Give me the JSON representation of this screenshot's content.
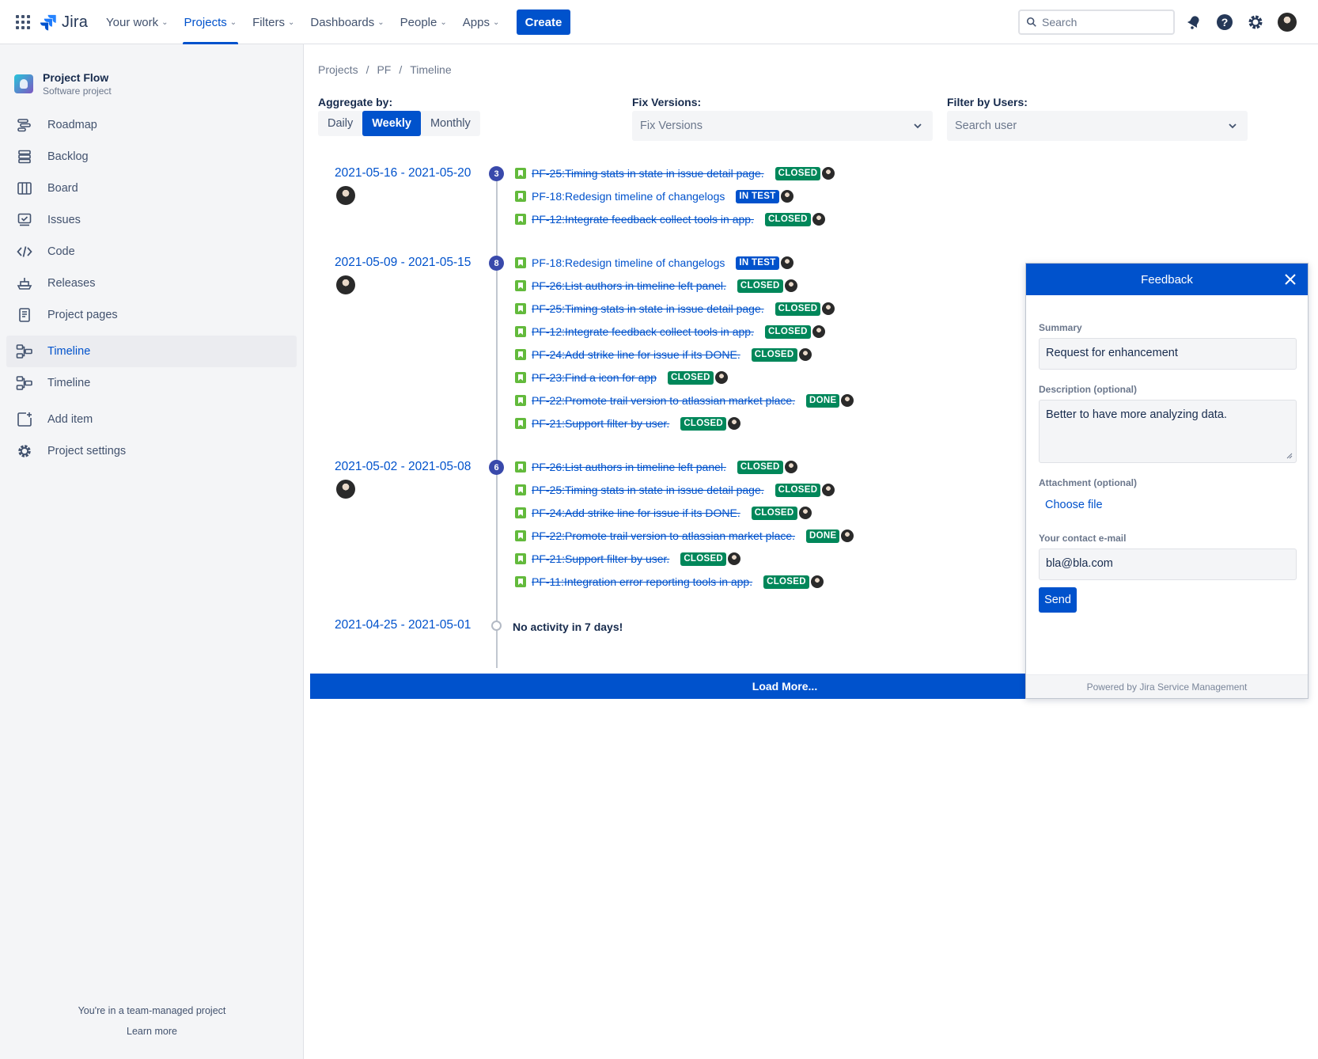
{
  "topnav": {
    "logo_text": "Jira",
    "menu": [
      {
        "label": "Your work",
        "active": false
      },
      {
        "label": "Projects",
        "active": true
      },
      {
        "label": "Filters",
        "active": false
      },
      {
        "label": "Dashboards",
        "active": false
      },
      {
        "label": "People",
        "active": false
      },
      {
        "label": "Apps",
        "active": false
      }
    ],
    "create_label": "Create",
    "search_placeholder": "Search",
    "icons": [
      "apps-grid-icon",
      "notifications-icon",
      "help-icon",
      "settings-icon",
      "profile-avatar"
    ]
  },
  "sidebar": {
    "project_name": "Project Flow",
    "project_type": "Software project",
    "items": [
      {
        "label": "Roadmap",
        "icon": "roadmap-icon"
      },
      {
        "label": "Backlog",
        "icon": "backlog-icon"
      },
      {
        "label": "Board",
        "icon": "board-icon"
      },
      {
        "label": "Issues",
        "icon": "issues-icon"
      },
      {
        "label": "Code",
        "icon": "code-icon"
      },
      {
        "label": "Releases",
        "icon": "releases-icon"
      },
      {
        "label": "Project pages",
        "icon": "project-pages-icon"
      },
      {
        "label": "Timeline",
        "icon": "timeline-icon",
        "active": true
      },
      {
        "label": "Timeline",
        "icon": "timeline-icon"
      },
      {
        "label": "Add item",
        "icon": "add-item-icon"
      },
      {
        "label": "Project settings",
        "icon": "settings-icon"
      }
    ],
    "footer_text": "You're in a team-managed project",
    "footer_link": "Learn more"
  },
  "breadcrumb": [
    "Projects",
    "PF",
    "Timeline"
  ],
  "filters": {
    "aggregate_label": "Aggregate by:",
    "aggregate_options": [
      "Daily",
      "Weekly",
      "Monthly"
    ],
    "aggregate_selected": "Weekly",
    "fix_versions_label": "Fix Versions:",
    "fix_versions_placeholder": "Fix Versions",
    "users_label": "Filter by Users:",
    "users_placeholder": "Search user"
  },
  "timeline": {
    "weeks": [
      {
        "range": "2021-05-16 - 2021-05-20",
        "count": "3",
        "issues": [
          {
            "key": "PF-25:Timing stats in state in issue detail page.",
            "status": "CLOSED",
            "color": "#00875a",
            "done": true
          },
          {
            "key": "PF-18:Redesign timeline of changelogs",
            "status": "IN TEST",
            "color": "#0052cc",
            "done": false
          },
          {
            "key": "PF-12:Integrate feedback collect tools in app.",
            "status": "CLOSED",
            "color": "#00875a",
            "done": true
          }
        ]
      },
      {
        "range": "2021-05-09 - 2021-05-15",
        "count": "8",
        "issues": [
          {
            "key": "PF-18:Redesign timeline of changelogs",
            "status": "IN TEST",
            "color": "#0052cc",
            "done": false
          },
          {
            "key": "PF-26:List authors in timeline left panel.",
            "status": "CLOSED",
            "color": "#00875a",
            "done": true
          },
          {
            "key": "PF-25:Timing stats in state in issue detail page.",
            "status": "CLOSED",
            "color": "#00875a",
            "done": true
          },
          {
            "key": "PF-12:Integrate feedback collect tools in app.",
            "status": "CLOSED",
            "color": "#00875a",
            "done": true
          },
          {
            "key": "PF-24:Add strike line for issue if its DONE.",
            "status": "CLOSED",
            "color": "#00875a",
            "done": true
          },
          {
            "key": "PF-23:Find a icon for app",
            "status": "CLOSED",
            "color": "#00875a",
            "done": true
          },
          {
            "key": "PF-22:Promote trail version to atlassian market place.",
            "status": "DONE",
            "color": "#00875a",
            "done": true
          },
          {
            "key": "PF-21:Support filter by user.",
            "status": "CLOSED",
            "color": "#00875a",
            "done": true
          }
        ]
      },
      {
        "range": "2021-05-02 - 2021-05-08",
        "count": "6",
        "issues": [
          {
            "key": "PF-26:List authors in timeline left panel.",
            "status": "CLOSED",
            "color": "#00875a",
            "done": true
          },
          {
            "key": "PF-25:Timing stats in state in issue detail page.",
            "status": "CLOSED",
            "color": "#00875a",
            "done": true
          },
          {
            "key": "PF-24:Add strike line for issue if its DONE.",
            "status": "CLOSED",
            "color": "#00875a",
            "done": true
          },
          {
            "key": "PF-22:Promote trail version to atlassian market place.",
            "status": "DONE",
            "color": "#00875a",
            "done": true
          },
          {
            "key": "PF-21:Support filter by user.",
            "status": "CLOSED",
            "color": "#00875a",
            "done": true
          },
          {
            "key": "PF-11:Integration error reporting tools in app.",
            "status": "CLOSED",
            "color": "#00875a",
            "done": true
          }
        ]
      },
      {
        "range": "2021-04-25 - 2021-05-01",
        "count": "",
        "empty_text": "No activity in 7 days!",
        "issues": []
      }
    ],
    "load_more": "Load More..."
  },
  "feedback": {
    "title": "Feedback",
    "summary_label": "Summary",
    "summary_value": "Request for enhancement",
    "description_label": "Description (optional)",
    "description_value": "Better to have more analyzing data.",
    "attachment_label": "Attachment (optional)",
    "attachment_button": "Choose file",
    "email_label": "Your contact e-mail",
    "email_value": "bla@bla.com",
    "send_label": "Send",
    "footer": "Powered by Jira Service Management"
  }
}
